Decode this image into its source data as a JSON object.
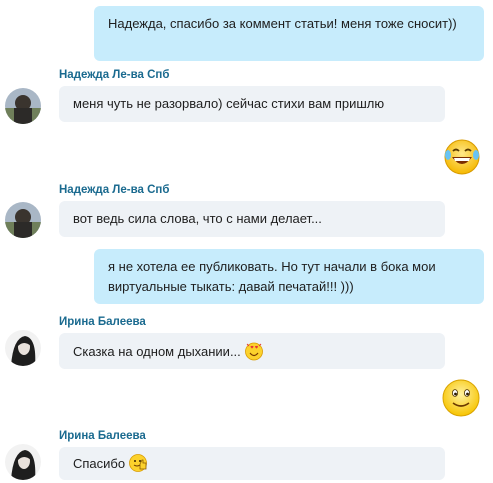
{
  "messages": [
    {
      "type": "out",
      "text": "Надежда, спасибо за коммент статьи! меня тоже сносит))"
    },
    {
      "type": "in",
      "sender": "Надежда Ле-ва Спб",
      "text": "меня чуть не разорвало) сейчас стихи вам пришлю"
    },
    {
      "type": "out-emoji",
      "icon": "laughing-tears-emoji-icon"
    },
    {
      "type": "in",
      "sender": "Надежда Ле-ва Спб",
      "text": "вот ведь сила слова, что с нами делает..."
    },
    {
      "type": "out",
      "text": "я не хотела ее публиковать. Но тут начали в бока мои виртуальные тыкать: давай печатай!!! )))"
    },
    {
      "type": "in",
      "sender": "Ирина Балеева",
      "text": "Сказка на одном дыхании...",
      "icon": "in-love-emoji-icon"
    },
    {
      "type": "out-emoji",
      "icon": "smile-emoji-icon"
    },
    {
      "type": "in",
      "sender": "Ирина Балеева",
      "text": "Спасибо",
      "icon": "thumbs-up-emoji-icon"
    }
  ],
  "colors": {
    "outgoing_bubble": "#c7ecfc",
    "incoming_bubble": "#eef2f6",
    "sender_name": "#1a6a8f"
  }
}
